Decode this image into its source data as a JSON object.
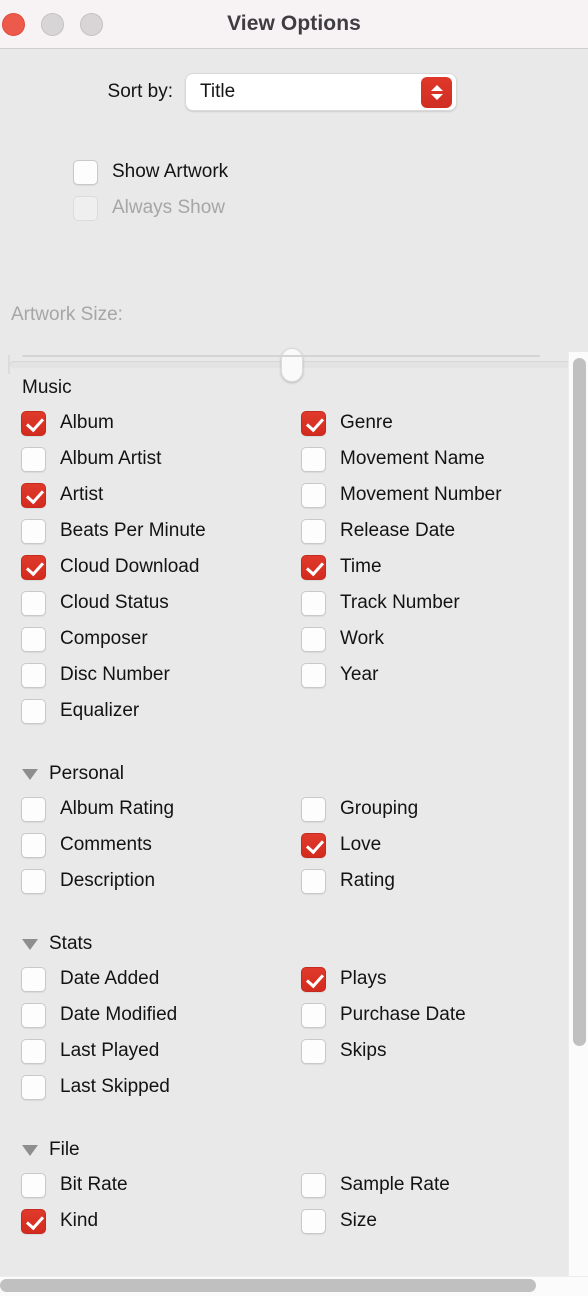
{
  "window": {
    "title": "View Options",
    "traffic_lights": [
      {
        "name": "close",
        "color": "#ec5a4c"
      },
      {
        "name": "minimize",
        "color": "#d8d5d6"
      },
      {
        "name": "zoom",
        "color": "#d8d5d6"
      }
    ]
  },
  "colors": {
    "accent_red": "#d32b1e",
    "titlebar_bg": "#f7f2f4",
    "window_bg": "#e9e9e9",
    "text": "#131313",
    "disabled_text": "#a6a6a6",
    "scrollbar_thumb": "#c0c0c0"
  },
  "sort": {
    "label": "Sort by:",
    "value": "Title",
    "options": [
      "Title"
    ]
  },
  "artwork": {
    "show_artwork": {
      "label": "Show Artwork",
      "checked": false,
      "disabled": false
    },
    "always_show": {
      "label": "Always Show",
      "checked": false,
      "disabled": true
    },
    "size_label": "Artwork Size:",
    "size_disabled": true,
    "size_value": 50
  },
  "sections": [
    {
      "title": "Music",
      "collapsible": false,
      "expanded": true,
      "left": [
        {
          "label": "Album",
          "checked": true
        },
        {
          "label": "Album Artist",
          "checked": false
        },
        {
          "label": "Artist",
          "checked": true
        },
        {
          "label": "Beats Per Minute",
          "checked": false
        },
        {
          "label": "Cloud Download",
          "checked": true
        },
        {
          "label": "Cloud Status",
          "checked": false
        },
        {
          "label": "Composer",
          "checked": false
        },
        {
          "label": "Disc Number",
          "checked": false
        },
        {
          "label": "Equalizer",
          "checked": false
        }
      ],
      "right": [
        {
          "label": "Genre",
          "checked": true
        },
        {
          "label": "Movement Name",
          "checked": false
        },
        {
          "label": "Movement Number",
          "checked": false
        },
        {
          "label": "Release Date",
          "checked": false
        },
        {
          "label": "Time",
          "checked": true
        },
        {
          "label": "Track Number",
          "checked": false
        },
        {
          "label": "Work",
          "checked": false
        },
        {
          "label": "Year",
          "checked": false
        }
      ]
    },
    {
      "title": "Personal",
      "collapsible": true,
      "expanded": true,
      "left": [
        {
          "label": "Album Rating",
          "checked": false
        },
        {
          "label": "Comments",
          "checked": false
        },
        {
          "label": "Description",
          "checked": false
        }
      ],
      "right": [
        {
          "label": "Grouping",
          "checked": false
        },
        {
          "label": "Love",
          "checked": true
        },
        {
          "label": "Rating",
          "checked": false
        }
      ]
    },
    {
      "title": "Stats",
      "collapsible": true,
      "expanded": true,
      "left": [
        {
          "label": "Date Added",
          "checked": false
        },
        {
          "label": "Date Modified",
          "checked": false
        },
        {
          "label": "Last Played",
          "checked": false
        },
        {
          "label": "Last Skipped",
          "checked": false
        }
      ],
      "right": [
        {
          "label": "Plays",
          "checked": true
        },
        {
          "label": "Purchase Date",
          "checked": false
        },
        {
          "label": "Skips",
          "checked": false
        }
      ]
    },
    {
      "title": "File",
      "collapsible": true,
      "expanded": true,
      "left": [
        {
          "label": "Bit Rate",
          "checked": false
        },
        {
          "label": "Kind",
          "checked": true
        }
      ],
      "right": [
        {
          "label": "Sample Rate",
          "checked": false
        },
        {
          "label": "Size",
          "checked": false
        }
      ]
    }
  ],
  "scrollbars": {
    "vertical": {
      "visible": true
    },
    "horizontal": {
      "visible": true
    }
  }
}
